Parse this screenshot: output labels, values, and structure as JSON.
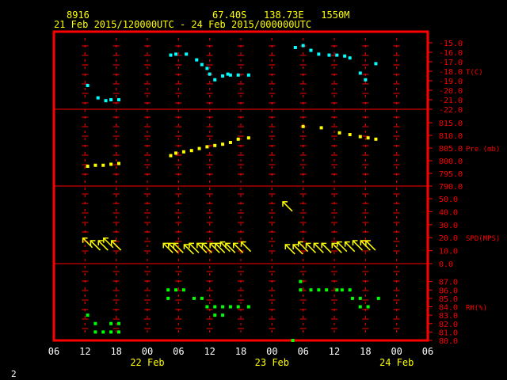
{
  "header": {
    "station": "8916",
    "location": "67.40S   138.73E   1550M",
    "period": "21 Feb 2015/120000UTC - 24 Feb 2015/000000UTC"
  },
  "footer": {
    "page_number": "2"
  },
  "colors": {
    "frame": "#ff0000",
    "labels": "#ff0000",
    "header": "#ffff00",
    "time_axis": "#ffffff",
    "date_axis": "#ffff00",
    "temperature": "#00ffff",
    "pressure": "#ffff00",
    "wind": "#ffff00",
    "humidity": "#00ff00"
  },
  "chart_data": {
    "type": "scatter",
    "x_axis": {
      "tick_labels": [
        "06",
        "12",
        "18",
        "00",
        "06",
        "12",
        "18",
        "00",
        "06",
        "12",
        "18",
        "00",
        "06"
      ],
      "range_hours": [
        0,
        72
      ],
      "date_labels": [
        {
          "hour": 18,
          "text": "22 Feb"
        },
        {
          "hour": 42,
          "text": "23 Feb"
        },
        {
          "hour": 66,
          "text": "24 Feb"
        }
      ]
    },
    "panels": [
      {
        "id": "temperature",
        "label": "T(C)",
        "ylim": [
          -22.0,
          -15.0
        ],
        "tick_labels": [
          "-15.0",
          "-16.0",
          "-17.0",
          "-18.0",
          "-19.0",
          "-20.0",
          "-21.0",
          "-22.0"
        ],
        "points": [
          [
            6.5,
            -19.5
          ],
          [
            8.5,
            -20.8
          ],
          [
            10.0,
            -21.1
          ],
          [
            11.0,
            -21.0
          ],
          [
            12.5,
            -21.0
          ],
          [
            22.5,
            -16.3
          ],
          [
            23.5,
            -16.2
          ],
          [
            25.5,
            -16.2
          ],
          [
            27.5,
            -16.8
          ],
          [
            28.5,
            -17.3
          ],
          [
            29.5,
            -17.7
          ],
          [
            30.0,
            -18.3
          ],
          [
            31.0,
            -18.9
          ],
          [
            32.5,
            -18.5
          ],
          [
            33.5,
            -18.3
          ],
          [
            34.0,
            -18.4
          ],
          [
            35.5,
            -18.4
          ],
          [
            37.5,
            -18.4
          ],
          [
            46.5,
            -15.5
          ],
          [
            48.0,
            -15.3
          ],
          [
            49.5,
            -15.8
          ],
          [
            51.0,
            -16.2
          ],
          [
            53.0,
            -16.3
          ],
          [
            54.5,
            -16.3
          ],
          [
            56.0,
            -16.4
          ],
          [
            57.0,
            -16.6
          ],
          [
            59.0,
            -18.2
          ],
          [
            60.0,
            -18.9
          ],
          [
            62.0,
            -17.2
          ]
        ]
      },
      {
        "id": "pressure",
        "label": "Pre (mb)",
        "ylim": [
          790.0,
          815.0
        ],
        "tick_labels": [
          "815.0",
          "810.0",
          "805.0",
          "800.0",
          "795.0",
          "790.0"
        ],
        "points": [
          [
            6.5,
            797.8
          ],
          [
            8.0,
            798.2
          ],
          [
            9.5,
            798.2
          ],
          [
            11.0,
            798.6
          ],
          [
            12.5,
            798.9
          ],
          [
            22.5,
            802.0
          ],
          [
            23.5,
            803.0
          ],
          [
            25.0,
            803.5
          ],
          [
            26.5,
            804.0
          ],
          [
            28.0,
            804.8
          ],
          [
            29.5,
            805.5
          ],
          [
            31.0,
            806.0
          ],
          [
            32.5,
            806.5
          ],
          [
            34.0,
            807.2
          ],
          [
            35.5,
            808.5
          ],
          [
            37.5,
            809.0
          ],
          [
            48.0,
            813.5
          ],
          [
            51.5,
            813.0
          ],
          [
            55.0,
            811.0
          ],
          [
            57.0,
            810.3
          ],
          [
            59.0,
            809.5
          ],
          [
            60.5,
            809.0
          ],
          [
            62.0,
            808.5
          ]
        ]
      },
      {
        "id": "wind",
        "label": "SPD(MPS)",
        "ylim": [
          0.0,
          50.0
        ],
        "tick_labels": [
          "50.0",
          "40.0",
          "30.0",
          "20.0",
          "10.0",
          "0.0"
        ],
        "points": [
          [
            6.5,
            16.0
          ],
          [
            8.0,
            14.0
          ],
          [
            9.5,
            14.0
          ],
          [
            10.5,
            16.0
          ],
          [
            12.0,
            14.0
          ],
          [
            22.0,
            12.0
          ],
          [
            23.0,
            12.0
          ],
          [
            24.0,
            12.0
          ],
          [
            26.0,
            11.0
          ],
          [
            27.0,
            12.0
          ],
          [
            28.5,
            12.0
          ],
          [
            29.5,
            12.0
          ],
          [
            31.0,
            12.0
          ],
          [
            32.0,
            12.0
          ],
          [
            33.0,
            13.0
          ],
          [
            34.0,
            12.0
          ],
          [
            35.5,
            12.0
          ],
          [
            37.0,
            13.0
          ],
          [
            45.0,
            44.0
          ],
          [
            45.5,
            11.0
          ],
          [
            47.0,
            11.0
          ],
          [
            48.0,
            13.0
          ],
          [
            49.5,
            12.0
          ],
          [
            51.0,
            12.0
          ],
          [
            52.5,
            12.0
          ],
          [
            54.5,
            12.0
          ],
          [
            55.5,
            13.0
          ],
          [
            57.0,
            13.0
          ],
          [
            58.5,
            14.0
          ],
          [
            60.0,
            14.0
          ],
          [
            61.0,
            14.0
          ]
        ]
      },
      {
        "id": "humidity",
        "label": "RH(%)",
        "ylim": [
          80.0,
          88.0
        ],
        "tick_labels": [
          "87.0",
          "86.0",
          "85.0",
          "84.0",
          "83.0",
          "82.0",
          "81.0",
          "80.0"
        ],
        "points": [
          [
            6.5,
            83.0
          ],
          [
            8.0,
            82.0
          ],
          [
            8.0,
            81.0
          ],
          [
            9.5,
            81.0
          ],
          [
            11.0,
            82.0
          ],
          [
            11.0,
            81.0
          ],
          [
            12.5,
            82.0
          ],
          [
            12.5,
            81.0
          ],
          [
            22.0,
            86.0
          ],
          [
            22.0,
            85.0
          ],
          [
            23.5,
            86.0
          ],
          [
            25.0,
            86.0
          ],
          [
            27.0,
            85.0
          ],
          [
            28.5,
            85.0
          ],
          [
            29.5,
            84.0
          ],
          [
            31.0,
            84.0
          ],
          [
            31.0,
            83.0
          ],
          [
            32.5,
            84.0
          ],
          [
            32.5,
            83.0
          ],
          [
            34.0,
            84.0
          ],
          [
            35.5,
            84.0
          ],
          [
            37.5,
            84.0
          ],
          [
            46.0,
            80.0
          ],
          [
            47.5,
            86.0
          ],
          [
            47.5,
            87.0
          ],
          [
            49.5,
            86.0
          ],
          [
            51.0,
            86.0
          ],
          [
            52.5,
            86.0
          ],
          [
            54.5,
            86.0
          ],
          [
            55.5,
            86.0
          ],
          [
            57.0,
            86.0
          ],
          [
            57.5,
            85.0
          ],
          [
            59.0,
            85.0
          ],
          [
            59.0,
            84.0
          ],
          [
            60.5,
            84.0
          ],
          [
            62.5,
            85.0
          ]
        ]
      }
    ]
  }
}
